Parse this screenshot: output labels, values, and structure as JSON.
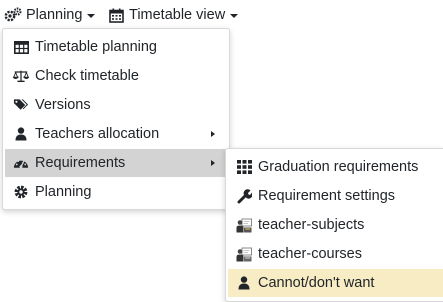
{
  "topbar": {
    "planning_label": "Planning",
    "timetable_view_label": "Timetable view"
  },
  "main_menu": {
    "items": [
      {
        "label": "Timetable planning",
        "icon": "table-icon"
      },
      {
        "label": "Check timetable",
        "icon": "balance-scale-icon"
      },
      {
        "label": "Versions",
        "icon": "tags-icon"
      },
      {
        "label": "Teachers allocation",
        "icon": "user-icon"
      },
      {
        "label": "Requirements",
        "icon": "tachometer-icon"
      },
      {
        "label": "Planning",
        "icon": "cog-icon"
      }
    ]
  },
  "sub_menu": {
    "items": [
      {
        "label": "Graduation requirements",
        "icon": "grid-icon"
      },
      {
        "label": "Requirement settings",
        "icon": "wrench-icon"
      },
      {
        "label": "teacher-subjects",
        "icon": "teacher-subjects-icon"
      },
      {
        "label": "teacher-courses",
        "icon": "teacher-courses-icon"
      },
      {
        "label": "Cannot/don't want",
        "icon": "user-icon"
      }
    ]
  },
  "colors": {
    "active_item_bg": "#d3d3d3",
    "highlight_item_bg": "#f7ecc3",
    "text": "#212529"
  }
}
